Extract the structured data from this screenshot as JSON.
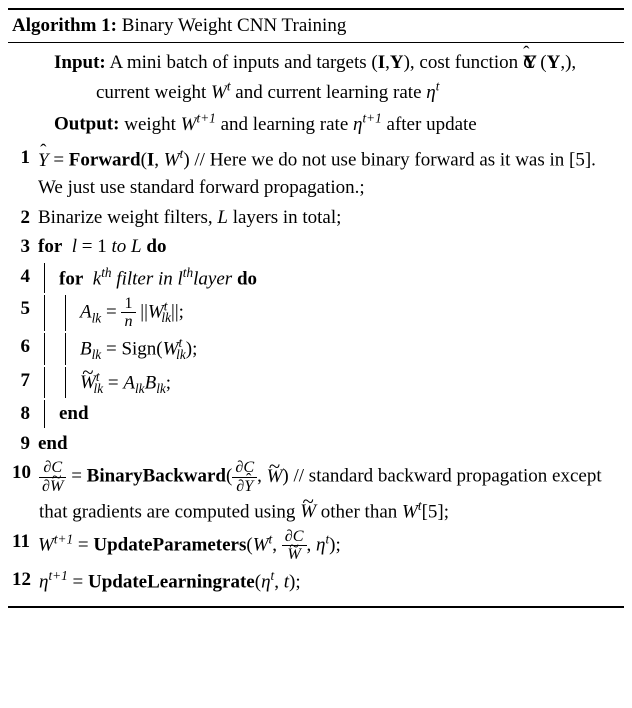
{
  "title": {
    "label": "Algorithm 1:",
    "text": "Binary Weight CNN Training"
  },
  "io": {
    "input_label": "Input:",
    "input_text": "A mini batch of inputs and targets (I,Y), cost function C (Y,Ŷ), current weight Wᵗ and current learning rate ηᵗ",
    "output_label": "Output:",
    "output_text": "weight Wᵗ⁺¹ and learning rate ηᵗ⁺¹ after update"
  },
  "lines": {
    "l1": {
      "num": "1",
      "content_prefix": "Ŷ = ",
      "fn": "Forward",
      "args": "(I, Wᵗ)",
      "comment": " // Here we do not use binary forward as it was in [5]. We just use standard forward propagation.;"
    },
    "l2": {
      "num": "2",
      "content": "Binarize weight filters, L layers in total;"
    },
    "l3": {
      "num": "3",
      "kw": "for",
      "cond": " l = 1 to L ",
      "kw2": "do"
    },
    "l4": {
      "num": "4",
      "kw": "for",
      "cond": " kᵗʰ filter in lᵗʰ layer ",
      "kw2": "do"
    },
    "l5": {
      "num": "5",
      "content": "A_lk = (1/n) ||W_lk^t||;"
    },
    "l6": {
      "num": "6",
      "content": "B_lk = Sign(W_lk^t);"
    },
    "l7": {
      "num": "7",
      "content": "W̃_lk^t = A_lk B_lk;"
    },
    "l8": {
      "num": "8",
      "kw": "end"
    },
    "l9": {
      "num": "9",
      "kw": "end"
    },
    "l10": {
      "num": "10",
      "lhs": "∂C/∂W̃ = ",
      "fn": "BinaryBackward",
      "args": "(∂C/∂Ŷ, W̃)",
      "comment": " // standard backward propagation except that gradients are computed using W̃ other than Wᵗ[5];"
    },
    "l11": {
      "num": "11",
      "lhs": "Wᵗ⁺¹ = ",
      "fn": "UpdateParameters",
      "args": "(Wᵗ, ∂C/∂W̃, ηᵗ);"
    },
    "l12": {
      "num": "12",
      "lhs": "ηᵗ⁺¹ = ",
      "fn": "UpdateLearningrate",
      "args": "(ηᵗ, t);"
    }
  }
}
